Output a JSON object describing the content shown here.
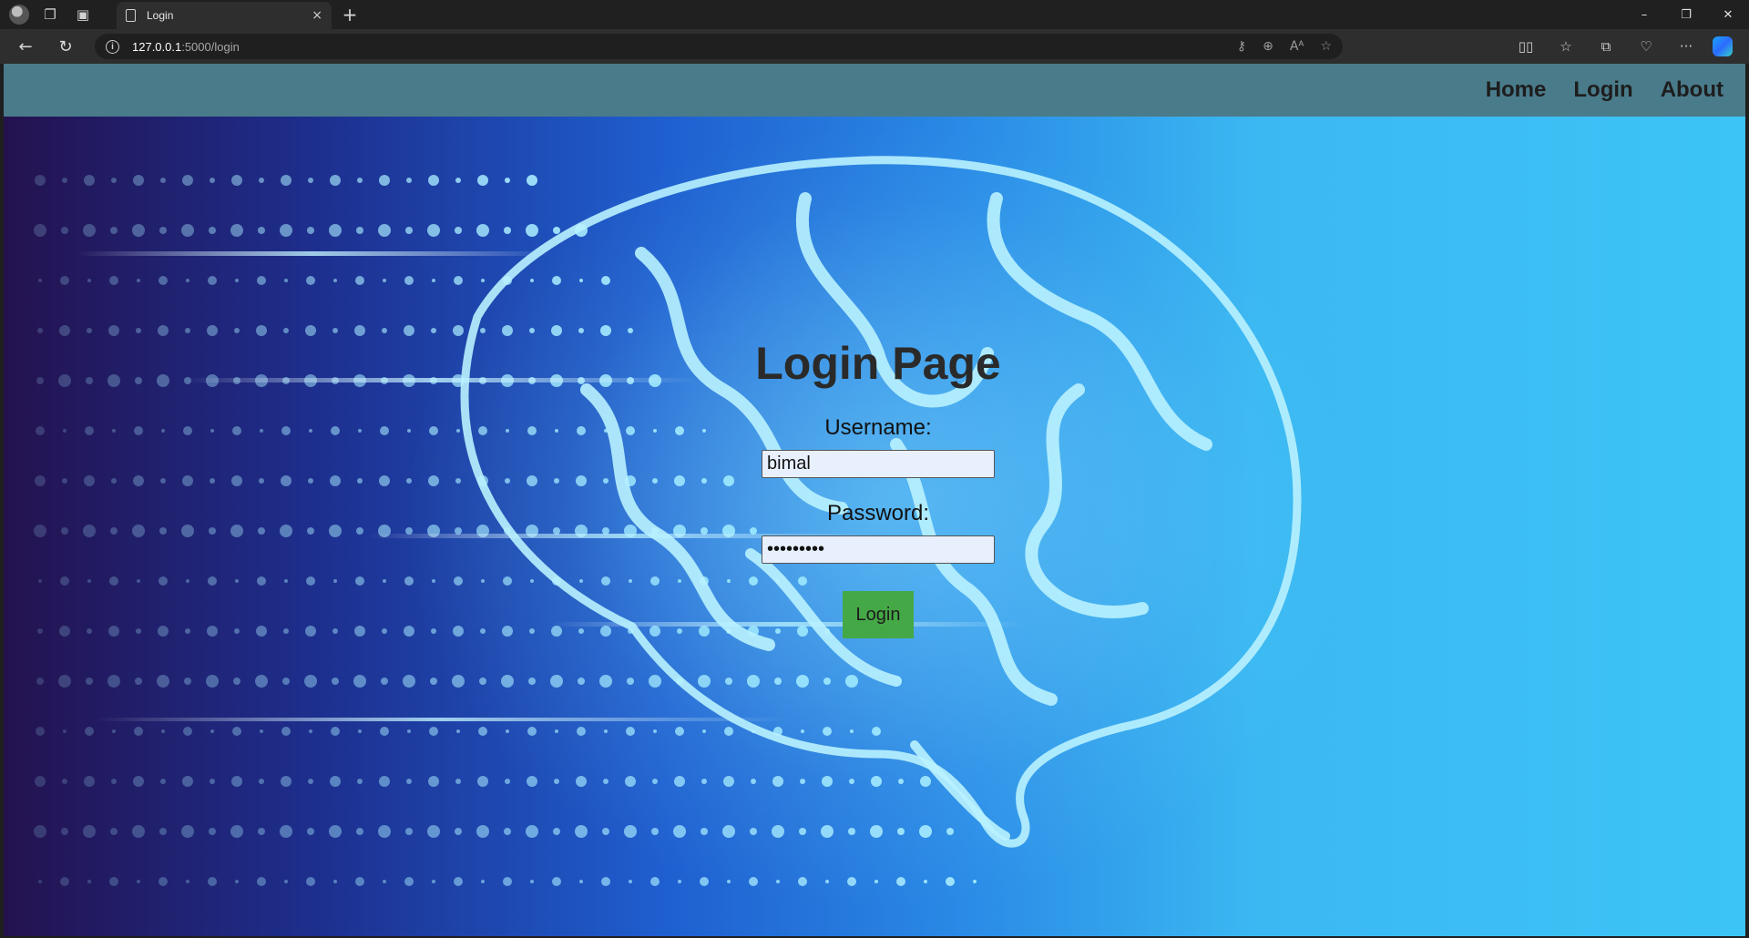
{
  "browser": {
    "tab_title": "Login",
    "url_host": "127.0.0.1",
    "url_path": ":5000/login",
    "new_tab_symbol": "+",
    "tab_close_symbol": "×",
    "window_controls": {
      "minimize": "–",
      "restore": "❐",
      "close": "✕"
    },
    "nav": {
      "back": "←",
      "refresh": "↻"
    },
    "url_icons": [
      "key-icon",
      "zoom-icon",
      "read-aloud-icon",
      "favorite-star-icon"
    ],
    "url_icon_glyphs": {
      "key": "⚷",
      "zoom": "⊕",
      "read_aloud": "Aᴬ",
      "star": "☆"
    },
    "toolbar_glyphs": {
      "split": "▯▯",
      "favorites": "☆",
      "collections": "⧉",
      "health": "♡",
      "more": "···"
    }
  },
  "page": {
    "navbar": {
      "links": [
        "Home",
        "Login",
        "About"
      ]
    },
    "title": "Login Page",
    "username_label": "Username:",
    "username_value": "bimal",
    "password_label": "Password:",
    "password_value": "bimal1234",
    "submit_label": "Login"
  },
  "colors": {
    "navbar_bg": "#4a7b8a",
    "login_button": "#45a847",
    "input_bg": "#e8f0fe",
    "bg_left": "#24124f",
    "bg_right": "#3cc4f6"
  }
}
